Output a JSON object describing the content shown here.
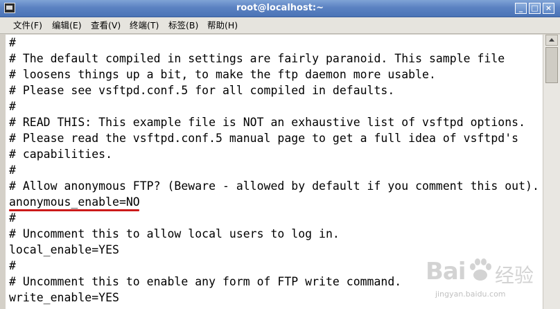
{
  "window": {
    "title": "root@localhost:~",
    "buttons": {
      "minimize": "_",
      "maximize": "□",
      "close": "×"
    }
  },
  "menubar": {
    "items": [
      {
        "label": "文件(F)"
      },
      {
        "label": "编辑(E)"
      },
      {
        "label": "查看(V)"
      },
      {
        "label": "终端(T)"
      },
      {
        "label": "标签(B)"
      },
      {
        "label": "帮助(H)"
      }
    ]
  },
  "terminal": {
    "lines": [
      "#",
      "# The default compiled in settings are fairly paranoid. This sample file",
      "# loosens things up a bit, to make the ftp daemon more usable.",
      "# Please see vsftpd.conf.5 for all compiled in defaults.",
      "#",
      "# READ THIS: This example file is NOT an exhaustive list of vsftpd options.",
      "# Please read the vsftpd.conf.5 manual page to get a full idea of vsftpd's",
      "# capabilities.",
      "#",
      "# Allow anonymous FTP? (Beware - allowed by default if you comment this out).",
      "anonymous_enable=NO",
      "#",
      "# Uncomment this to allow local users to log in.",
      "local_enable=YES",
      "#",
      "# Uncomment this to enable any form of FTP write command.",
      "write_enable=YES"
    ],
    "highlighted_line_index": 10
  },
  "watermark": {
    "logo": "Bai",
    "brand": "经验",
    "url": "jingyan.baidu.com"
  },
  "colors": {
    "titlebar": "#5b82c2",
    "highlight_underline": "#cc1a1a"
  }
}
